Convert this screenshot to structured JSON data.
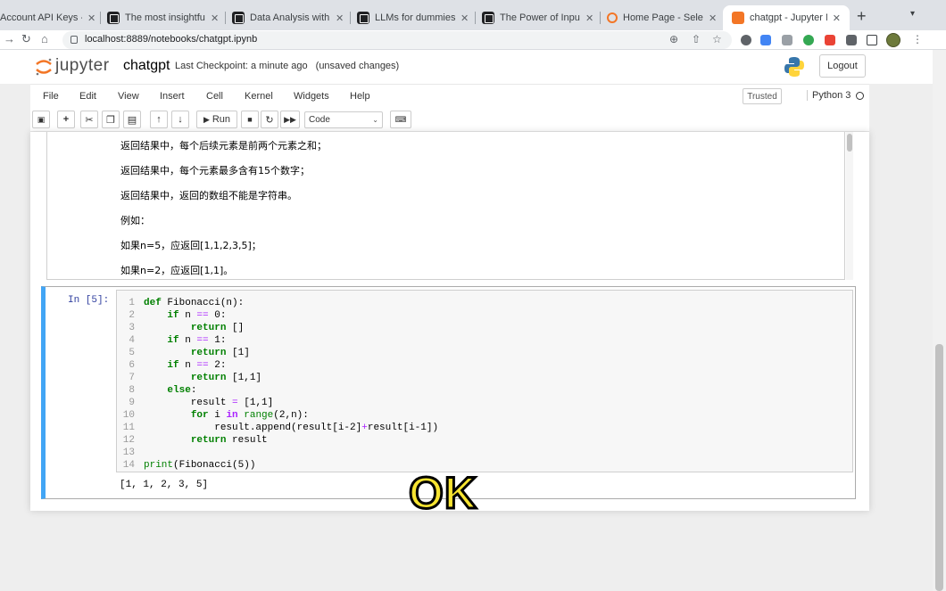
{
  "browser": {
    "tabs": [
      {
        "title": "Account API Keys - O",
        "icon": "openai-icon"
      },
      {
        "title": "The most insightful st",
        "icon": "notion-icon"
      },
      {
        "title": "Data Analysis with Ch",
        "icon": "notion-icon"
      },
      {
        "title": "LLMs for dummies —",
        "icon": "notion-icon"
      },
      {
        "title": "The Power of Input: H",
        "icon": "notion-icon"
      },
      {
        "title": "Home Page - Select o",
        "icon": "jupyter-icon"
      },
      {
        "title": "chatgpt - Jupyter Not",
        "icon": "jupyter-icon",
        "active": true
      }
    ],
    "close_glyph": "✕",
    "new_tab_glyph": "+",
    "url": "localhost:8889/notebooks/chatgpt.ipynb"
  },
  "jupyter": {
    "logo_text": "jupyter",
    "notebook_name": "chatgpt",
    "checkpoint": "Last Checkpoint: a minute ago",
    "unsaved": "(unsaved changes)",
    "logout": "Logout",
    "menu": [
      "File",
      "Edit",
      "View",
      "Insert",
      "Cell",
      "Kernel",
      "Widgets",
      "Help"
    ],
    "trusted": "Trusted",
    "kernel_name": "Python 3",
    "toolbar": {
      "run_label": "Run",
      "cell_type": "Code"
    }
  },
  "markdown_lines": [
    "返回结果中，每个后续元素是前两个元素之和；",
    "返回结果中，每个元素最多含有15个数字；",
    "返回结果中，返回的数组不能是字符串。",
    "例如：",
    "如果n=5，应返回[1,1,2,3,5]；",
    "如果n=2，应返回[1,1]。"
  ],
  "code_cell": {
    "prompt": "In [5]:",
    "lines": [
      {
        "n": "1",
        "text": "def Fibonacci(n):"
      },
      {
        "n": "2",
        "text": "    if n == 0:"
      },
      {
        "n": "3",
        "text": "        return []"
      },
      {
        "n": "4",
        "text": "    if n == 1:"
      },
      {
        "n": "5",
        "text": "        return [1]"
      },
      {
        "n": "6",
        "text": "    if n == 2:"
      },
      {
        "n": "7",
        "text": "        return [1,1]"
      },
      {
        "n": "8",
        "text": "    else:"
      },
      {
        "n": "9",
        "text": "        result = [1,1]"
      },
      {
        "n": "10",
        "text": "        for i in range(2,n):"
      },
      {
        "n": "11",
        "text": "            result.append(result[i-2]+result[i-1])"
      },
      {
        "n": "12",
        "text": "        return result"
      },
      {
        "n": "13",
        "text": ""
      },
      {
        "n": "14",
        "text": "print(Fibonacci(5))"
      }
    ],
    "output": "[1, 1, 2, 3, 5]"
  },
  "caption": "OK"
}
